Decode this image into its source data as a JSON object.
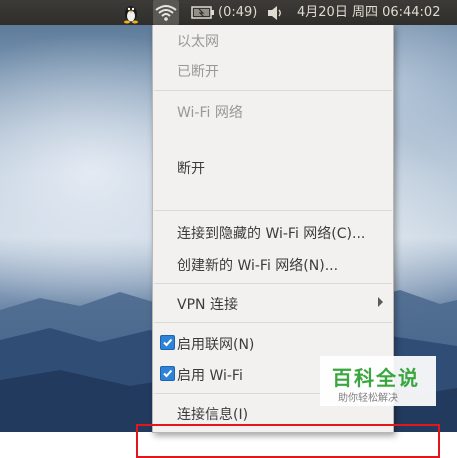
{
  "top_panel": {
    "battery_time": "(0:49)",
    "clock": "4月20日 周四 06:44:02"
  },
  "network_menu": {
    "ethernet_header": "以太网",
    "ethernet_status": "已断开",
    "wifi_header": "Wi-Fi 网络",
    "disconnect": "断开",
    "connect_hidden": "连接到隐藏的 Wi-Fi 网络(C)...",
    "create_new": "创建新的 Wi-Fi 网络(N)...",
    "vpn": "VPN 连接",
    "enable_networking": "启用联网(N)",
    "enable_networking_checked": true,
    "enable_wifi": "启用 Wi-Fi",
    "enable_wifi_checked": true,
    "connection_info": "连接信息(I)"
  },
  "watermark": {
    "title": "百科全说",
    "subtitle": "助你轻松解决"
  },
  "colors": {
    "panel_bg": "#3c3b37",
    "menu_bg": "#f2f1f0",
    "checkbox": "#2e83d9",
    "highlight_box": "#e2161b",
    "watermark_green": "#3aa63e"
  },
  "icons": {
    "tray": [
      "tux-icon",
      "wifi-icon",
      "battery-icon",
      "volume-icon"
    ],
    "menu": [
      "submenu-arrow-icon",
      "checkbox-checked-icon"
    ]
  }
}
